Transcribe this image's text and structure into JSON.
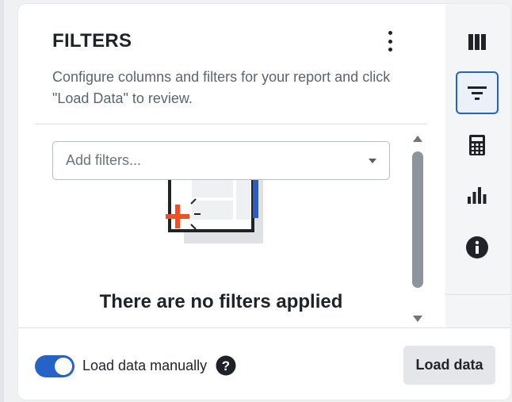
{
  "panel": {
    "title": "FILTERS",
    "description": "Configure columns and filters for your report and click \"Load Data\" to review."
  },
  "filters": {
    "placeholder": "Add filters...",
    "empty_message": "There are no filters applied"
  },
  "rail": {
    "items": [
      {
        "icon": "columns-icon",
        "active": false
      },
      {
        "icon": "filter-icon",
        "active": true
      },
      {
        "icon": "calculator-icon",
        "active": false
      },
      {
        "icon": "bar-chart-icon",
        "active": false
      },
      {
        "icon": "info-icon",
        "active": false
      }
    ]
  },
  "footer": {
    "toggle_label": "Load data manually",
    "toggle_on": true,
    "load_button": "Load data"
  },
  "colors": {
    "accent": "#2563c9",
    "illustration_plus": "#f04e23",
    "illustration_blue": "#2a5cc8"
  }
}
